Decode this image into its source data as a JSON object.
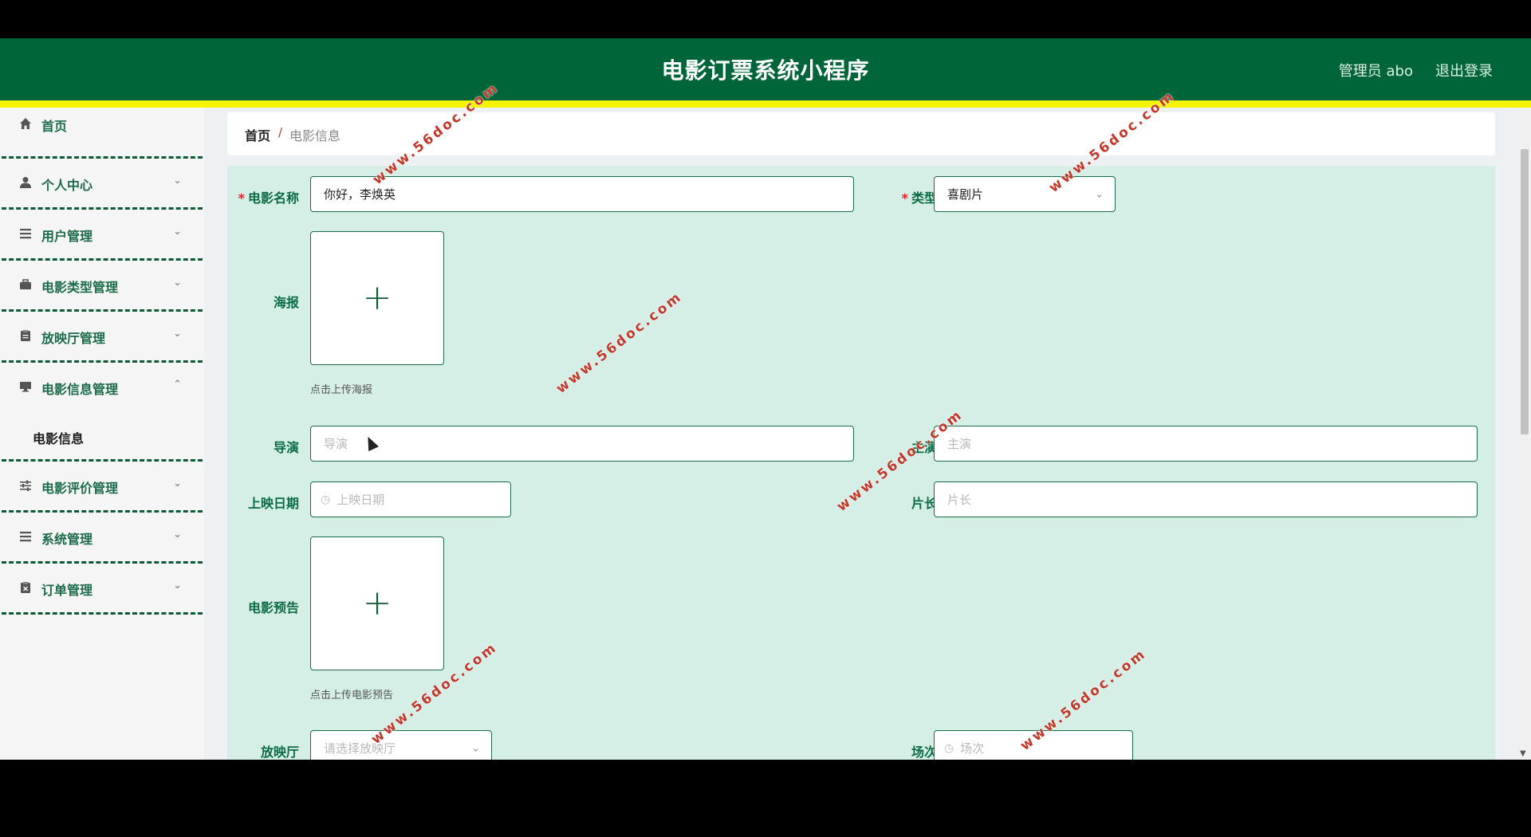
{
  "header": {
    "title": "电影订票系统小程序",
    "user": "管理员 abo",
    "logout": "退出登录"
  },
  "sidebar": {
    "items": [
      {
        "label": "首页",
        "icon": "home-icon"
      },
      {
        "label": "个人中心",
        "icon": "user-icon"
      },
      {
        "label": "用户管理",
        "icon": "list-icon"
      },
      {
        "label": "电影类型管理",
        "icon": "briefcase-icon"
      },
      {
        "label": "放映厅管理",
        "icon": "clipboard-icon"
      },
      {
        "label": "电影信息管理",
        "icon": "monitor-icon"
      },
      {
        "label": "电影评价管理",
        "icon": "sliders-icon"
      },
      {
        "label": "系统管理",
        "icon": "list-icon"
      },
      {
        "label": "订单管理",
        "icon": "clipboard-x-icon"
      }
    ],
    "submenu_label": "电影信息"
  },
  "breadcrumb": {
    "home": "首页",
    "separator": "/",
    "current": "电影信息"
  },
  "form": {
    "movie_name": {
      "label": "电影名称",
      "value": "你好，李焕英"
    },
    "type": {
      "label": "类型",
      "value": "喜剧片"
    },
    "poster": {
      "label": "海报",
      "hint": "点击上传海报"
    },
    "director": {
      "label": "导演",
      "placeholder": "导演"
    },
    "actor": {
      "label": "主演",
      "placeholder": "主演"
    },
    "release_date": {
      "label": "上映日期",
      "placeholder": "上映日期"
    },
    "duration": {
      "label": "片长",
      "placeholder": "片长"
    },
    "trailer": {
      "label": "电影预告",
      "hint": "点击上传电影预告"
    },
    "hall": {
      "label": "放映厅",
      "placeholder": "请选择放映厅"
    },
    "session": {
      "label": "场次",
      "placeholder": "场次"
    }
  },
  "watermark": "www.56doc.com",
  "colors": {
    "header_bg": "#00663a",
    "accent_bar": "#f4f400",
    "form_bg": "#d6efe6",
    "label": "#0b6b44"
  }
}
